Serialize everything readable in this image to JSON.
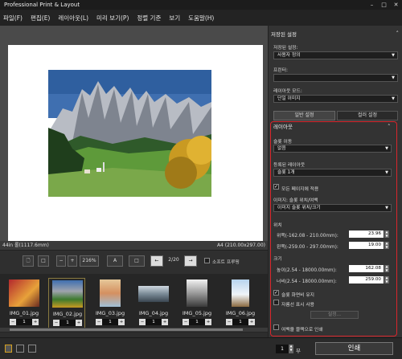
{
  "app": {
    "title": "Professional Print & Layout"
  },
  "menu": [
    "파일(F)",
    "편집(E)",
    "레이아웃(L)",
    "미리 보기(P)",
    "정렬 기준",
    "보기",
    "도움말(H)"
  ],
  "status": {
    "pages": "44in 롤(1117.6mm)",
    "paper": "A4 (210.00x297.00)"
  },
  "toolbar": {
    "zoom": "216%",
    "page": "2/20",
    "soft_proof": "소프트 프루핑"
  },
  "thumbs": [
    {
      "name": "IMG_01.jpg",
      "count": "1"
    },
    {
      "name": "IMG_02.jpg",
      "count": "1"
    },
    {
      "name": "IMG_03.jpg",
      "count": "1"
    },
    {
      "name": "IMG_04.jpg",
      "count": "1"
    },
    {
      "name": "IMG_05.jpg",
      "count": "1"
    },
    {
      "name": "IMG_06.jpg",
      "count": "1"
    }
  ],
  "panel": {
    "saved_header": "저장된 설정",
    "saved_label": "저장된 설정:",
    "saved_value": "사용자 정의",
    "printer_label": "프린터:",
    "printer_value": "",
    "layout_mode_label": "레이아웃 모드:",
    "layout_mode_value": "단일 이미지",
    "tab_general": "일반 설정",
    "tab_color": "컬러 설정",
    "layout_header": "레이아웃",
    "slot_move_label": "슬롯 이동",
    "slot_move_value": "없음",
    "reg_layout_label": "등록된 레이아웃",
    "reg_layout_value": "슬롯 1개",
    "apply_all": "모든 페이지에 적용",
    "img_slot_label": "이미지: 슬롯 위치/여백",
    "img_slot_value": "이미지 슬롯 위치/크기",
    "position_header": "위치",
    "top_label": "위쪽(-162.08 - 210.00mm):",
    "top_value": "23.96",
    "left_label": "왼쪽(-259.00 - 297.00mm):",
    "left_value": "19.00",
    "size_header": "크기",
    "height_label": "높이(2.54 - 18000.00mm):",
    "height_value": "162.08",
    "width_label": "너비(2.54 - 18000.00mm):",
    "width_value": "259.00",
    "keep_ratio": "슬롯 화면비 유지",
    "use_guides": "자름선 표시 사용",
    "settings_btn": "설정...",
    "black_margin": "여백을 블랙으로 인쇄"
  },
  "bottom": {
    "copies": "1",
    "copies_unit": "부",
    "print": "인쇄"
  },
  "colors": {
    "highlight": "#d9262c",
    "accent": "#5a8fd6"
  }
}
